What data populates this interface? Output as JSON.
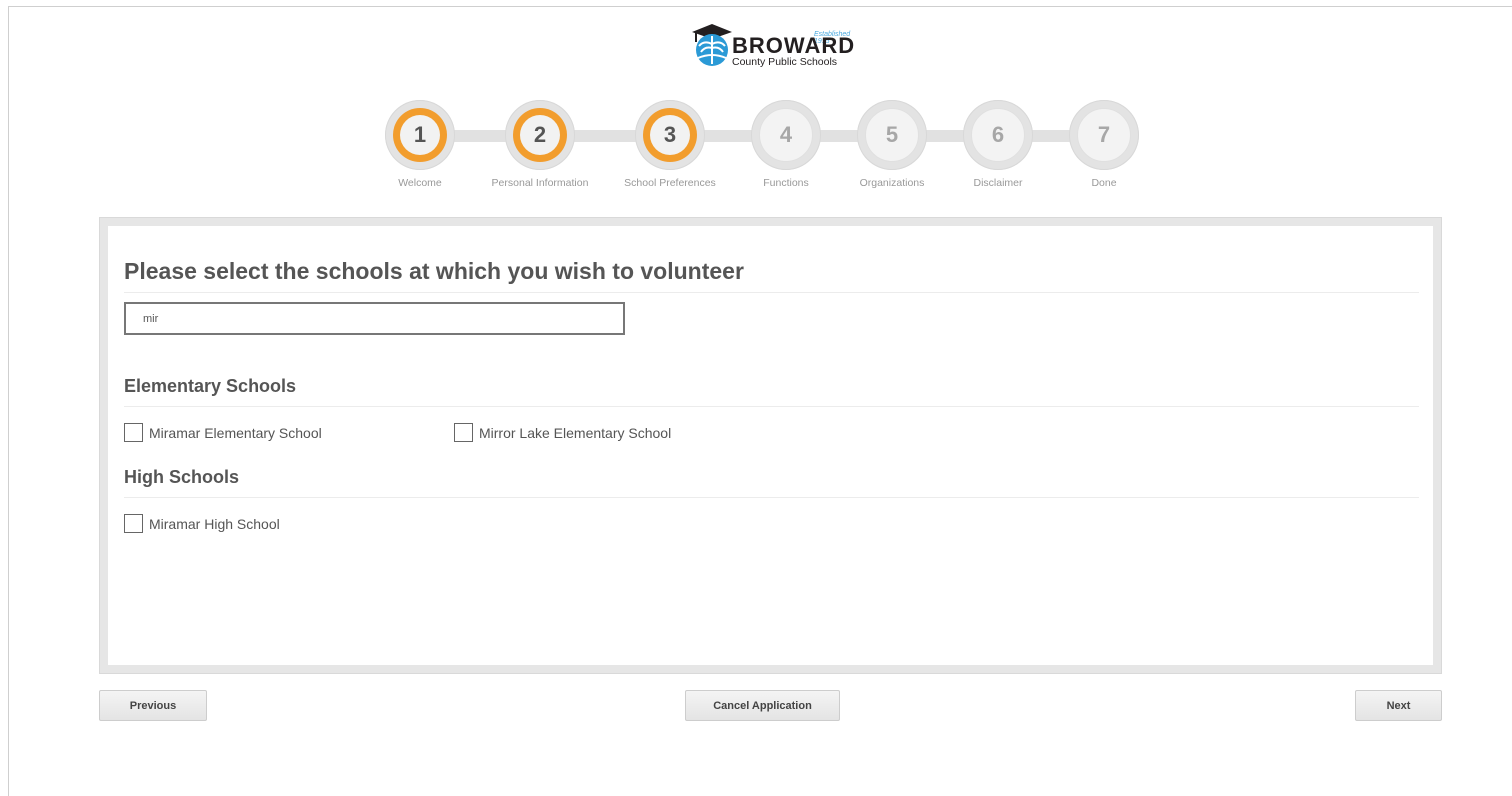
{
  "logo": {
    "established": "Established 1915",
    "name": "BROWARD",
    "subtitle": "County Public Schools"
  },
  "steps": [
    {
      "number": "1",
      "label": "Welcome",
      "state": "complete"
    },
    {
      "number": "2",
      "label": "Personal Information",
      "state": "complete"
    },
    {
      "number": "3",
      "label": "School Preferences",
      "state": "current"
    },
    {
      "number": "4",
      "label": "Functions",
      "state": "pending"
    },
    {
      "number": "5",
      "label": "Organizations",
      "state": "pending"
    },
    {
      "number": "6",
      "label": "Disclaimer",
      "state": "pending"
    },
    {
      "number": "7",
      "label": "Done",
      "state": "pending"
    }
  ],
  "main": {
    "title": "Please select the schools at which you wish to volunteer",
    "search_value": "mir",
    "sections": [
      {
        "title": "Elementary Schools",
        "schools": [
          {
            "name": "Miramar Elementary School",
            "checked": false
          },
          {
            "name": "Mirror Lake Elementary School",
            "checked": false
          }
        ]
      },
      {
        "title": "High Schools",
        "schools": [
          {
            "name": "Miramar High School",
            "checked": false
          }
        ]
      }
    ]
  },
  "buttons": {
    "previous": "Previous",
    "cancel": "Cancel Application",
    "next": "Next"
  },
  "colors": {
    "accent": "#f29d2d",
    "step_pending": "#a7a7a7",
    "panel_border": "#e6e6e6"
  }
}
